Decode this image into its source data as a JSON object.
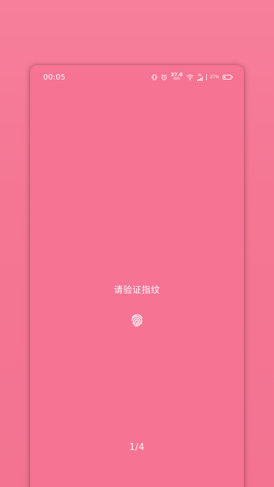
{
  "status_bar": {
    "time": "00:05",
    "icons": [
      "vibrate-icon",
      "alarm-icon",
      "network-speed-icon",
      "wifi-icon",
      "mobile-signal-icon",
      "battery-icon"
    ],
    "network_speed_value": "27.0",
    "network_speed_unit": "KB/S",
    "network_type": "4G",
    "battery_percent": "27%",
    "battery_level": 0.27
  },
  "lock_screen": {
    "prompt": "请验证指纹",
    "pager": "1/4"
  },
  "colors": {
    "background": "#f47693",
    "text": "#ffffff"
  }
}
